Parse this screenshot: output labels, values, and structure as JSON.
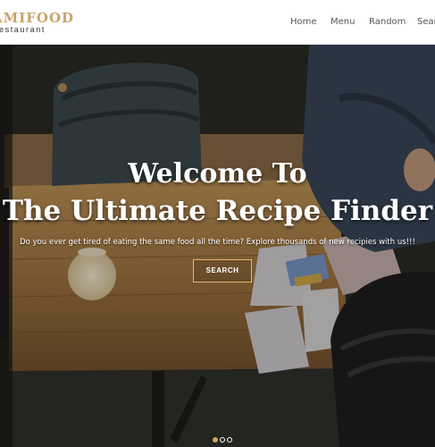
{
  "brand": {
    "name": "AMIFOOD",
    "subtitle": "estaurant"
  },
  "nav": {
    "items": [
      "Home",
      "Menu",
      "Random",
      "Searc"
    ]
  },
  "hero": {
    "heading_line1": "Welcome To",
    "heading_line2": "The Ultimate Recipe Finder",
    "tagline": "Do you ever get tired of eating the same food all the time? Explore thousands of new recipies with us!!!",
    "search_label": "SEARCH"
  },
  "carousel": {
    "slide_count": 3,
    "active_index": 0
  },
  "colors": {
    "brand_gold": "#c9a36b",
    "accent_border": "#e4b76d",
    "active_dot": "#d9a45c"
  },
  "icons": [
    "backpack-illustration",
    "mug-illustration",
    "table-illustration",
    "jacket-illustration"
  ]
}
